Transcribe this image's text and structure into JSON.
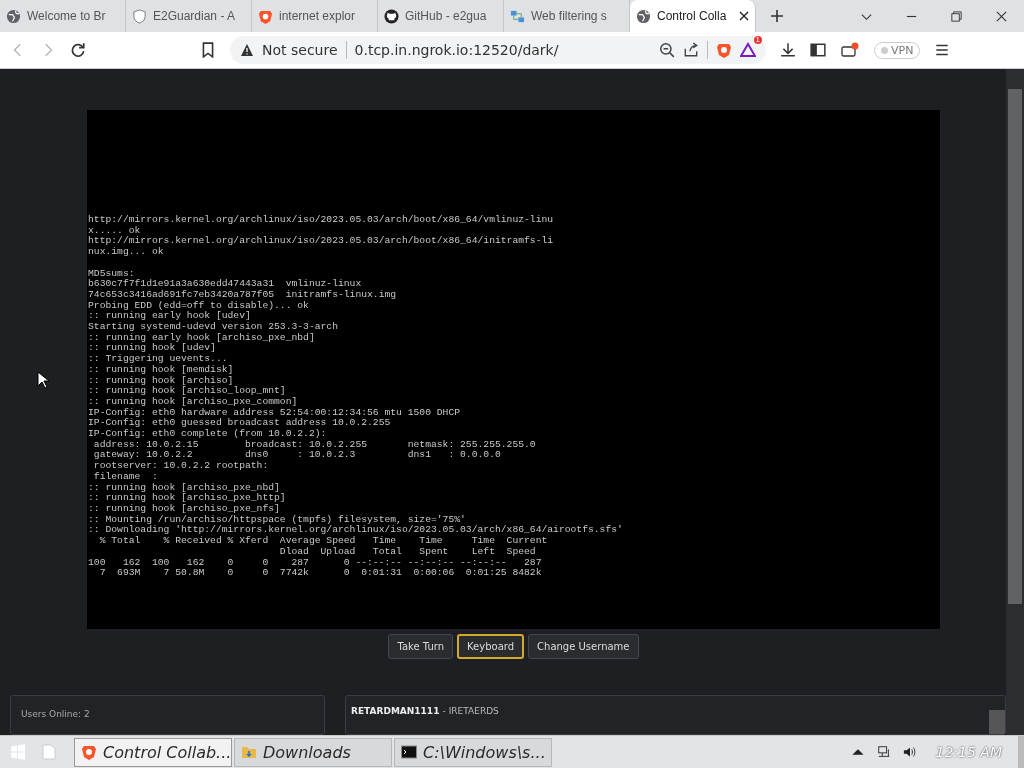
{
  "browser": {
    "tabs": [
      {
        "title": "Welcome to Br",
        "kind": "globe",
        "selected": false
      },
      {
        "title": "E2Guardian - A",
        "kind": "shield",
        "selected": false
      },
      {
        "title": "internet explor",
        "kind": "lion",
        "selected": false
      },
      {
        "title": "GitHub - e2gua",
        "kind": "cat",
        "selected": false
      },
      {
        "title": "Web filtering s",
        "kind": "network",
        "selected": false
      },
      {
        "title": "Control Colla",
        "kind": "globe",
        "selected": true
      }
    ],
    "security": "Not secure",
    "url": "0.tcp.in.ngrok.io:12520/dark/",
    "rewards_badge": "1",
    "vpn": "VPN"
  },
  "console": {
    "lines": [
      "http://mirrors.kernel.org/archlinux/iso/2023.05.03/arch/boot/x86_64/vmlinuz-linu",
      "x..... ok",
      "http://mirrors.kernel.org/archlinux/iso/2023.05.03/arch/boot/x86_64/initramfs-li",
      "nux.img... ok",
      "\nMD5sums:",
      "b630c7f7f1d1e91a3a630edd47443a31  vmlinuz-linux",
      "74c653c3416ad691fc7eb3420a787f05  initramfs-linux.img",
      "Probing EDD (edd=off to disable)... ok",
      ":: running early hook [udev]",
      "Starting systemd-udevd version 253.3-3-arch",
      ":: running early hook [archiso_pxe_nbd]",
      ":: running hook [udev]",
      ":: Triggering uevents...",
      ":: running hook [memdisk]",
      ":: running hook [archiso]",
      ":: running hook [archiso_loop_mnt]",
      ":: running hook [archiso_pxe_common]",
      "IP-Config: eth0 hardware address 52:54:00:12:34:56 mtu 1500 DHCP",
      "IP-Config: eth0 guessed broadcast address 10.0.2.255",
      "IP-Config: eth0 complete (from 10.0.2.2):",
      " address: 10.0.2.15        broadcast: 10.0.2.255       netmask: 255.255.255.0",
      " gateway: 10.0.2.2         dns0     : 10.0.2.3         dns1   : 0.0.0.0",
      " rootserver: 10.0.2.2 rootpath:",
      " filename  :",
      ":: running hook [archiso_pxe_nbd]",
      ":: running hook [archiso_pxe_http]",
      ":: running hook [archiso_pxe_nfs]",
      ":: Mounting /run/archiso/httpspace (tmpfs) filesystem, size='75%'",
      ":: Downloading 'http://mirrors.kernel.org/archlinux/iso/2023.05.03/arch/x86_64/airootfs.sfs'",
      "  % Total    % Received % Xferd  Average Speed   Time    Time     Time  Current",
      "                                 Dload  Upload   Total   Spent    Left  Speed",
      "100   162  100   162    0     0    287      0 --:--:-- --:--:-- --:--:--   287",
      "  7  693M    7 50.8M    0     0  7742k      0  0:01:31  0:00:06  0:01:25 8482k"
    ]
  },
  "controls": [
    {
      "label": "Take Turn",
      "selected": false
    },
    {
      "label": "Keyboard",
      "selected": true
    },
    {
      "label": "Change Username",
      "selected": false
    }
  ],
  "users_online": "Users Online: 2",
  "chat": [
    {
      "user": "RETARDMAN1111",
      "separator": "-",
      "message": "IRETAERDS"
    }
  ],
  "taskbar": {
    "items": [
      {
        "label": "Control Collab...",
        "kind": "lion",
        "selected": true
      },
      {
        "label": "Downloads",
        "kind": "folder",
        "selected": false
      },
      {
        "label": "C:\\Windows\\s...",
        "kind": "terminal",
        "selected": false
      }
    ],
    "clock": "12:15 AM"
  }
}
